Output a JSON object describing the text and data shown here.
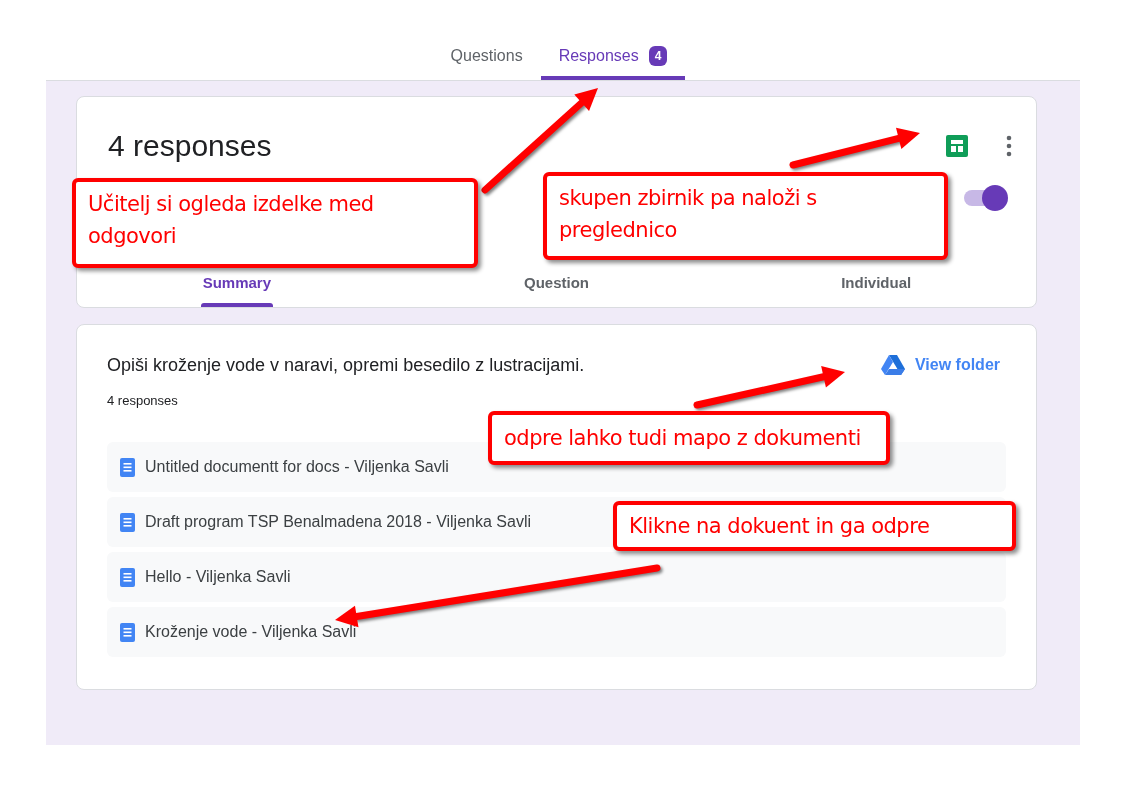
{
  "tabs": [
    {
      "label": "Questions",
      "selected": false
    },
    {
      "label": "Responses",
      "selected": true,
      "badge": "4"
    }
  ],
  "summary_card": {
    "title": "4 responses",
    "accepting_toggle": {
      "on": true
    },
    "view_tabs": [
      {
        "label": "Summary",
        "selected": true
      },
      {
        "label": "Question",
        "selected": false
      },
      {
        "label": "Individual",
        "selected": false
      }
    ]
  },
  "question_card": {
    "question": "Opiši kroženje vode v naravi, opremi besedilo z lustracijami.",
    "response_count": "4 responses",
    "view_folder": "View folder",
    "files": [
      {
        "name": "Untitled documentt for docs - Viljenka Savli"
      },
      {
        "name": "Draft program TSP Benalmadena 2018 - Viljenka Savli"
      },
      {
        "name": "Hello - Viljenka Savli"
      },
      {
        "name": "Kroženje vode - Viljenka Savli"
      }
    ]
  },
  "annotations": [
    {
      "text": "Učitelj si ogleda izdelke med odgovori"
    },
    {
      "text": "skupen zbirnik pa naloži s preglednico"
    },
    {
      "text": "odpre lahko tudi mapo z dokumenti"
    },
    {
      "text": "Klikne na dokuent in ga odpre"
    }
  ]
}
